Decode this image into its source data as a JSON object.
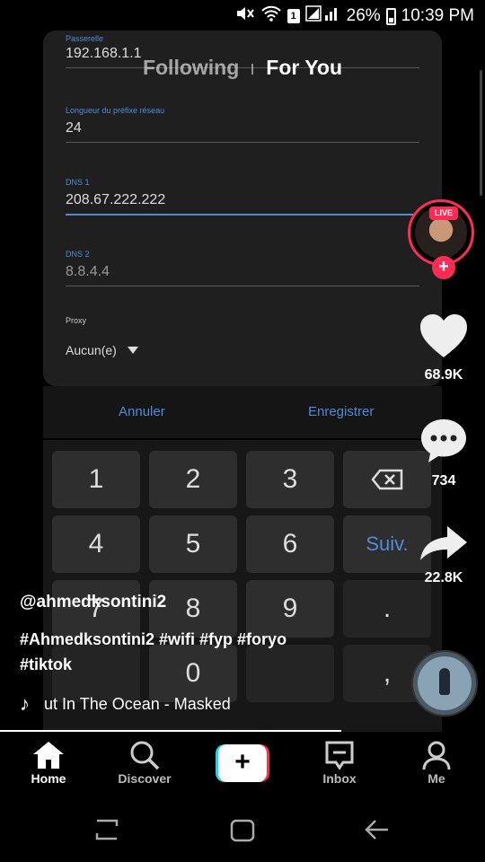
{
  "status_bar": {
    "battery": "26%",
    "time": "10:39 PM",
    "sim_slot": "1"
  },
  "feed_tabs": {
    "following": "Following",
    "for_you": "For You"
  },
  "video_content": {
    "gateway": {
      "label": "Passerelle",
      "value": "192.168.1.1"
    },
    "prefix": {
      "label": "Longueur du préfixe réseau",
      "value": "24"
    },
    "dns1": {
      "label": "DNS 1",
      "value": "208.67.222.222"
    },
    "dns2": {
      "label": "DNS 2",
      "value": "8.8.4.4"
    },
    "proxy": {
      "label": "Proxy",
      "value": "Aucun(e)"
    },
    "cancel": "Annuler",
    "save": "Enregistrer",
    "keys": [
      "1",
      "2",
      "3",
      "4",
      "5",
      "6",
      "7",
      "8",
      "9",
      "0",
      "Suiv.",
      ".",
      ","
    ]
  },
  "creator": {
    "live_badge": "LIVE",
    "follow": "+"
  },
  "actions": {
    "likes": "68.9K",
    "comments": "734",
    "shares": "22.8K"
  },
  "caption": {
    "handle": "@ahmedksontini2",
    "tags_line1": "#Ahmedksontini2 #wifi #fyp #foryo",
    "tags_line2": "#tiktok",
    "music": "ut In The Ocean - Masked",
    "music_icon": "♪"
  },
  "nav": {
    "home": "Home",
    "discover": "Discover",
    "create": "+",
    "inbox": "Inbox",
    "me": "Me"
  },
  "colors": {
    "accent_red": "#fe2c55",
    "accent_cyan": "#20d5ec",
    "android_blue": "#4f8bd9"
  }
}
